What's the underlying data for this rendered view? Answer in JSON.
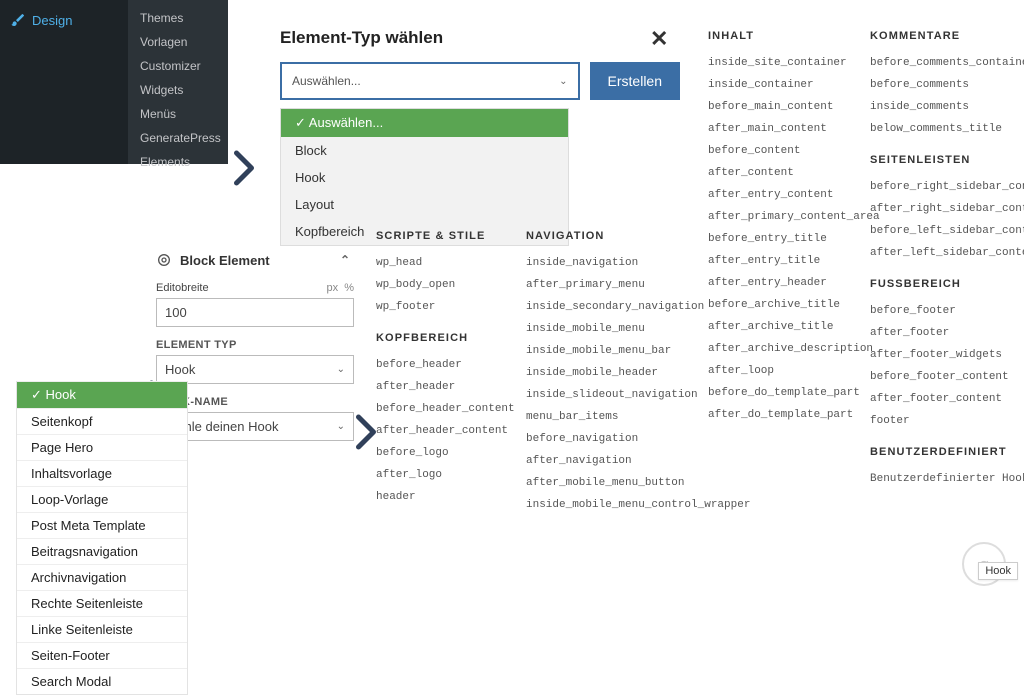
{
  "wp": {
    "main": "Design",
    "sub": [
      "Themes",
      "Vorlagen",
      "Customizer",
      "Widgets",
      "Menüs",
      "GeneratePress",
      "Elements"
    ]
  },
  "chooser": {
    "title": "Element-Typ wählen",
    "placeholder": "Auswählen...",
    "create": "Erstellen",
    "options": [
      "Auswählen...",
      "Block",
      "Hook",
      "Layout",
      "Kopfbereich"
    ]
  },
  "block": {
    "title": "Block Element",
    "editor_width_label": "Editobreite",
    "units_px": "px",
    "units_pct": "%",
    "editor_width_value": "100",
    "element_typ_label": "ELEMENT TYP",
    "element_typ_value": "Hook",
    "hook_name_label": "HOOK-NAME",
    "hook_name_value": "Wähle deinen Hook"
  },
  "typ_list": [
    "Hook",
    "Seitenkopf",
    "Page Hero",
    "Inhaltsvorlage",
    "Loop-Vorlage",
    "Post Meta Template",
    "Beitragsnavigation",
    "Archivnavigation",
    "Rechte Seitenleiste",
    "Linke Seitenleiste",
    "Seiten-Footer",
    "Search Modal"
  ],
  "cols_left": [
    {
      "h": "Scripte &amp; Stile",
      "items": [
        "wp_head",
        "wp_body_open",
        "wp_footer"
      ]
    },
    {
      "h": "Kopfbereich",
      "items": [
        "before_header",
        "after_header",
        "before_header_content",
        "after_header_content",
        "before_logo",
        "after_logo",
        "header"
      ]
    }
  ],
  "col_nav": {
    "h": "Navigation",
    "items": [
      "inside_navigation",
      "after_primary_menu",
      "inside_secondary_navigation",
      "inside_mobile_menu",
      "inside_mobile_menu_bar",
      "inside_mobile_header",
      "inside_slideout_navigation",
      "menu_bar_items",
      "before_navigation",
      "after_navigation",
      "after_mobile_menu_button",
      "inside_mobile_menu_control_wrapper"
    ]
  },
  "col_inhalt": {
    "h": "Inhalt",
    "items": [
      "inside_site_container",
      "inside_container",
      "before_main_content",
      "after_main_content",
      "before_content",
      "after_content",
      "after_entry_content",
      "after_primary_content_area",
      "before_entry_title",
      "after_entry_title",
      "after_entry_header",
      "before_archive_title",
      "after_archive_title",
      "after_archive_description",
      "after_loop",
      "before_do_template_part",
      "after_do_template_part"
    ]
  },
  "cols_right": [
    {
      "h": "Kommentare",
      "items": [
        "before_comments_container",
        "before_comments",
        "inside_comments",
        "below_comments_title"
      ]
    },
    {
      "h": "Seitenleisten",
      "items": [
        "before_right_sidebar_content",
        "after_right_sidebar_content",
        "before_left_sidebar_content",
        "after_left_sidebar_content"
      ]
    },
    {
      "h": "Fussbereich",
      "items": [
        "before_footer",
        "after_footer",
        "after_footer_widgets",
        "before_footer_content",
        "after_footer_content",
        "footer"
      ]
    },
    {
      "h": "Benutzerdefiniert",
      "items": [
        "Benutzerdefinierter Hook"
      ]
    }
  ],
  "badge": "Hook"
}
